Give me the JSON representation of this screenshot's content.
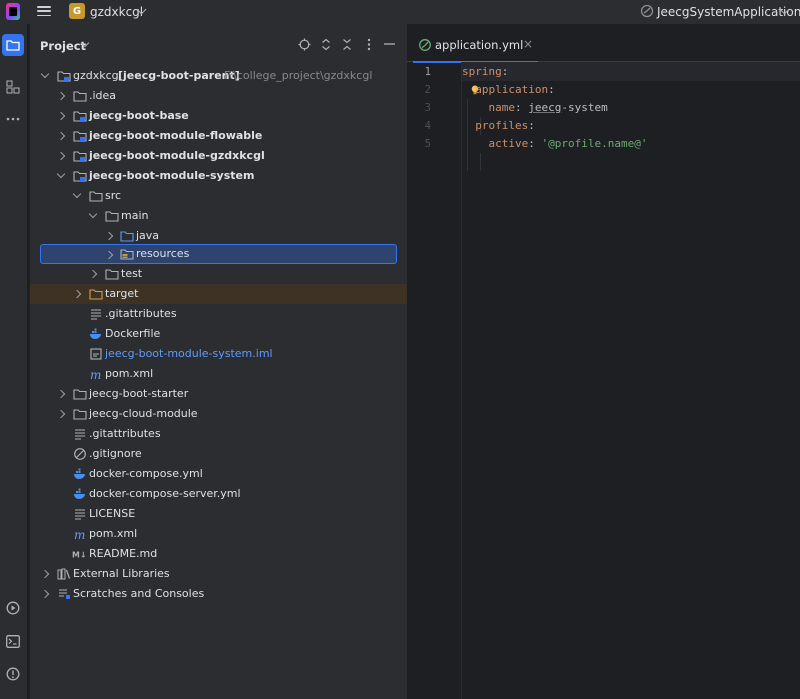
{
  "titlebar": {
    "project_badge": "G",
    "project_name": "gzdxkcgl",
    "run_config": "JeecgSystemApplication"
  },
  "panel": {
    "title": "Project"
  },
  "tree": {
    "root_name": "gzdxkcgl",
    "root_module": "[jeecg-boot-parent]",
    "root_path": "F:\\college_project\\gzdxkcgl",
    "idea": ".idea",
    "base": "jeecg-boot-base",
    "flowable": "jeecg-boot-module-flowable",
    "gzdxkcgl_mod": "jeecg-boot-module-gzdxkcgl",
    "system": "jeecg-boot-module-system",
    "src": "src",
    "main": "main",
    "java": "java",
    "resources": "resources",
    "test": "test",
    "target": "target",
    "sys_gitattributes": ".gitattributes",
    "dockerfile": "Dockerfile",
    "iml": "jeecg-boot-module-system.iml",
    "sys_pom": "pom.xml",
    "starter": "jeecg-boot-starter",
    "cloud": "jeecg-cloud-module",
    "gitattributes": ".gitattributes",
    "gitignore": ".gitignore",
    "compose": "docker-compose.yml",
    "compose_server": "docker-compose-server.yml",
    "license": "LICENSE",
    "pom": "pom.xml",
    "readme": "README.md",
    "ext_libs": "External Libraries",
    "scratches": "Scratches and Consoles"
  },
  "editor": {
    "tab_label": "application.yml",
    "tab_close": "×",
    "line_numbers": [
      "1",
      "2",
      "3",
      "4",
      "5"
    ],
    "code": {
      "l1_key": "spring",
      "l1_colon": ":",
      "l2_key": "application",
      "l2_colon": ":",
      "l3_key": "name",
      "l3_colon": ": ",
      "l3_val_a": "jeecg",
      "l3_val_b": "-system",
      "l4_key": "profiles",
      "l4_colon": ":",
      "l5_key": "active",
      "l5_colon": ": ",
      "l5_val": "'@profile.name@'"
    }
  },
  "colors": {
    "accent": "#3574f0",
    "selection": "#2e436e",
    "excluded_row": "#3d3223",
    "yaml_key": "#cf8e6d",
    "yaml_string": "#6aab73"
  }
}
